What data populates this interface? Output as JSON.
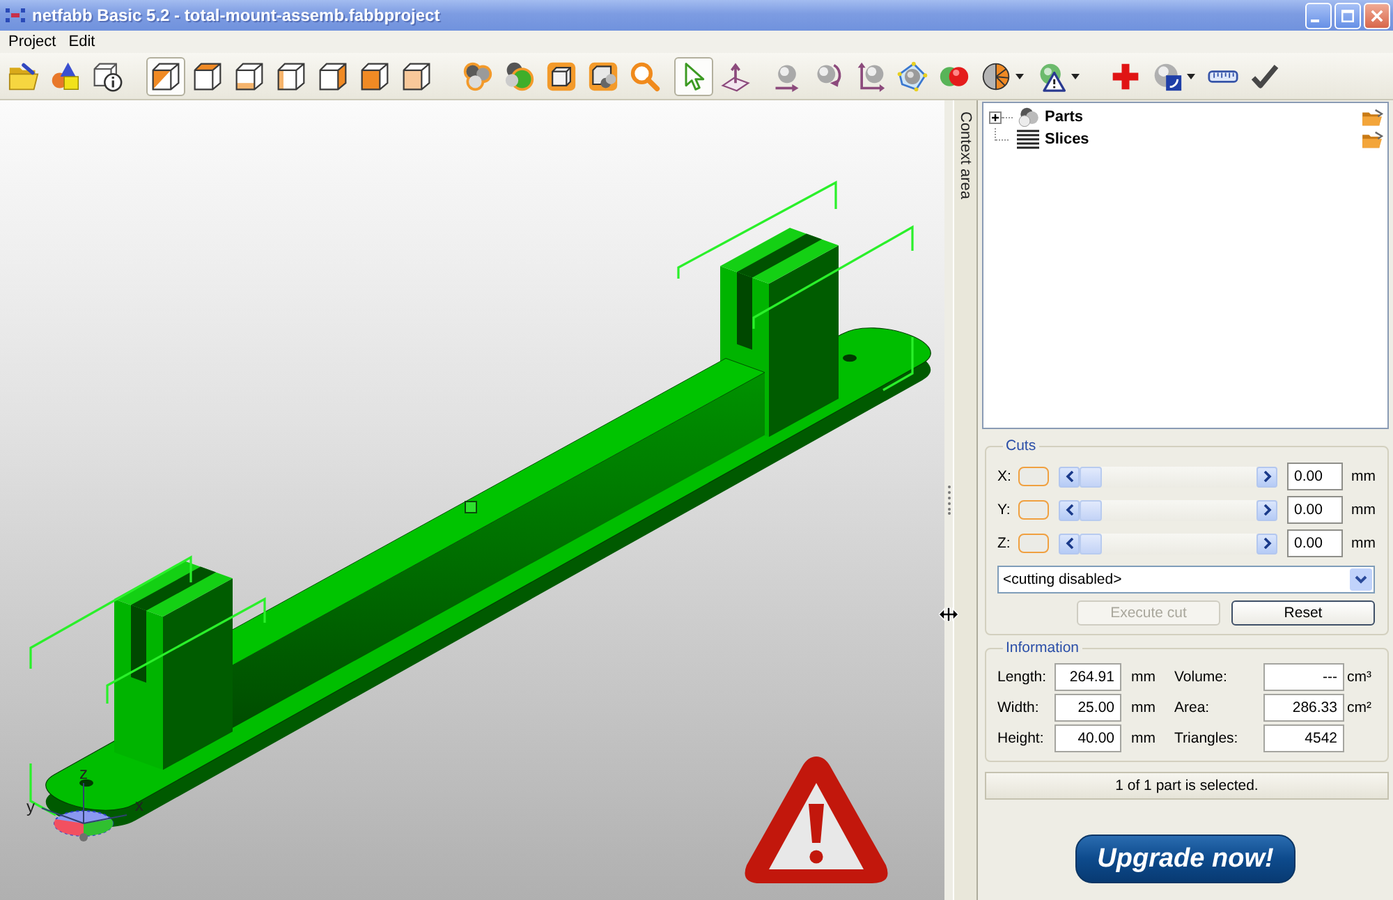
{
  "window": {
    "title": "netfabb Basic 5.2 - total-mount-assemb.fabbproject"
  },
  "menu": [
    "Project",
    "Edit"
  ],
  "toolbar": [
    {
      "items": [
        {
          "selected": false,
          "dropdown": false
        },
        {
          "selected": false,
          "dropdown": false
        },
        {
          "selected": false,
          "dropdown": false
        }
      ]
    },
    {
      "items": [
        {
          "selected": true,
          "dropdown": false
        },
        {
          "selected": false,
          "dropdown": false
        },
        {
          "selected": false,
          "dropdown": false
        },
        {
          "selected": false,
          "dropdown": false
        },
        {
          "selected": false,
          "dropdown": false
        },
        {
          "selected": false,
          "dropdown": false
        },
        {
          "selected": false,
          "dropdown": false
        }
      ]
    },
    {
      "items": [
        {
          "selected": false,
          "dropdown": false
        },
        {
          "selected": false,
          "dropdown": false
        },
        {
          "selected": false,
          "dropdown": false
        },
        {
          "selected": false,
          "dropdown": false
        },
        {
          "selected": false,
          "dropdown": false
        }
      ]
    },
    {
      "items": [
        {
          "selected": true,
          "dropdown": false
        },
        {
          "selected": false,
          "dropdown": false
        }
      ]
    },
    {
      "items": [
        {
          "selected": false,
          "dropdown": false
        },
        {
          "selected": false,
          "dropdown": false
        },
        {
          "selected": false,
          "dropdown": false
        }
      ]
    },
    {
      "items": [
        {
          "selected": false,
          "dropdown": false
        },
        {
          "selected": false,
          "dropdown": false
        },
        {
          "selected": false,
          "dropdown": true
        },
        {
          "selected": false,
          "dropdown": true
        }
      ]
    },
    {
      "items": [
        {
          "selected": false,
          "dropdown": false
        },
        {
          "selected": false,
          "dropdown": true
        },
        {
          "selected": false,
          "dropdown": false
        },
        {
          "selected": false,
          "dropdown": false
        }
      ]
    }
  ],
  "viewport": {
    "axis_labels": [
      "z",
      "y",
      "x"
    ]
  },
  "context_tab": {
    "label": "Context area"
  },
  "tree": {
    "items": [
      {
        "label": "Parts",
        "has_children": true,
        "expanded": false
      },
      {
        "label": "Slices",
        "has_children": false
      }
    ]
  },
  "cuts": {
    "title": "Cuts",
    "axes": [
      {
        "label": "X:",
        "level": 0,
        "value": "0.00",
        "unit": "mm"
      },
      {
        "label": "Y:",
        "level": 0,
        "value": "0.00",
        "unit": "mm"
      },
      {
        "label": "Z:",
        "level": 0,
        "value": "0.00",
        "unit": "mm"
      }
    ],
    "mode": "<cutting disabled>",
    "buttons": [
      {
        "label": "Execute cut",
        "disabled": true
      },
      {
        "label": "Reset",
        "disabled": false
      }
    ]
  },
  "information": {
    "title": "Information",
    "fields": [
      {
        "label": "Length:",
        "value": "264.91",
        "unit": "mm"
      },
      {
        "label": "Volume:",
        "value": "---",
        "unit": "cm³"
      },
      {
        "label": "Width:",
        "value": "25.00",
        "unit": "mm"
      },
      {
        "label": "Area:",
        "value": "286.33",
        "unit": "cm²"
      },
      {
        "label": "Height:",
        "value": "40.00",
        "unit": "mm"
      },
      {
        "label": "Triangles:",
        "value": "4542"
      }
    ]
  },
  "status_bar": {
    "text": "1 of 1 part is selected."
  },
  "upgrade_button": {
    "label": "Upgrade now!"
  }
}
